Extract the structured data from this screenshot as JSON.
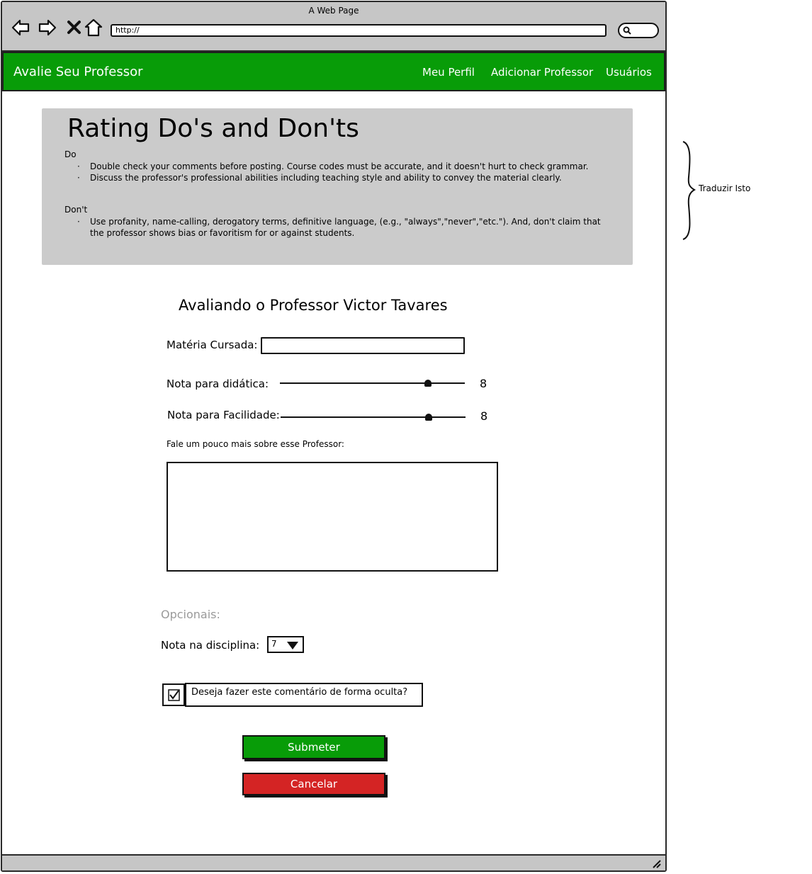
{
  "window": {
    "title": "A Web Page",
    "url": "http://"
  },
  "navbar": {
    "brand": "Avalie Seu Professor",
    "links": [
      "Meu Perfil",
      "Adicionar Professor",
      "Usuários"
    ]
  },
  "rules": {
    "title": "Rating Do's and Don'ts",
    "do_label": "Do",
    "do_items": [
      "Double check your comments before posting. Course codes must be accurate, and it doesn't hurt to check grammar.",
      "Discuss the professor's professional abilities including teaching style and ability to convey the material clearly."
    ],
    "dont_label": "Don't",
    "dont_items": [
      "Use profanity, name-calling, derogatory terms, definitive language, (e.g., \"always\",\"never\",\"etc.\"). And, don't claim that the professor shows bias or favoritism for or against students."
    ],
    "bullet": "·"
  },
  "form": {
    "title": "Avaliando o Professor Victor Tavares",
    "materia_label": "Matéria Cursada:",
    "materia_value": "",
    "didatica_label": "Nota para didática:",
    "didatica_value": "8",
    "didatica_level": 0.8,
    "facilidade_label": "Nota para Facilidade:",
    "facilidade_value": "8",
    "facilidade_level": 0.8,
    "comment_label": "Fale um pouco mais sobre esse Professor:",
    "comment_value": "",
    "optional_label": "Opcionais:",
    "disciplina_label": "Nota na disciplina:",
    "disciplina_value": "7",
    "hidden_label": "Deseja fazer este comentário de forma oculta?",
    "hidden_checked": true,
    "submit_label": "Submeter",
    "cancel_label": "Cancelar"
  },
  "annotation": {
    "note": "Traduzir Isto"
  },
  "colors": {
    "navbar": "#089c08",
    "submit": "#089c08",
    "cancel": "#d42424",
    "panel": "#cbcbcb",
    "chrome": "#c6c6c6"
  },
  "icons": [
    "back-arrow-icon",
    "forward-arrow-icon",
    "close-x-icon",
    "home-icon",
    "search-icon",
    "checkmark-icon",
    "resize-grip-icon",
    "curly-brace-icon"
  ]
}
